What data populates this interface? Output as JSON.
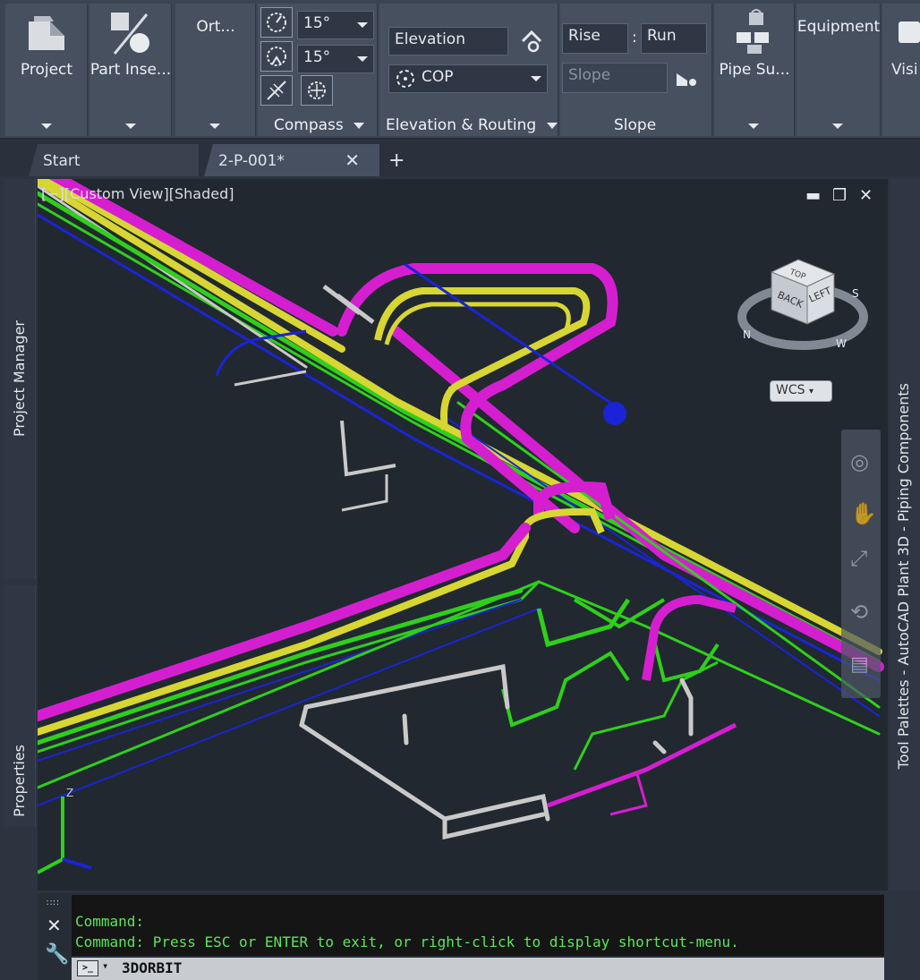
{
  "ribbon": {
    "project": {
      "label": "Project"
    },
    "part_insertion": {
      "label": "Part Inse..."
    },
    "ortho": {
      "label": "Ort..."
    },
    "compass": {
      "angle1": "15°",
      "angle2": "15°",
      "title": "Compass"
    },
    "elevation_routing": {
      "elevation_value": "Elevation",
      "justification": "COP",
      "title": "Elevation & Routing"
    },
    "slope": {
      "rise": "Rise",
      "separator": ":",
      "run": "Run",
      "slope_value": "Slope",
      "title": "Slope"
    },
    "pipe_supports": {
      "label": "Pipe Su..."
    },
    "equipment": {
      "label": "Equipment"
    },
    "visibility": {
      "label": "Visi"
    }
  },
  "tabs": [
    {
      "label": "Start"
    },
    {
      "label": "2-P-001*"
    }
  ],
  "viewport": {
    "label": "[−][Custom View][Shaded]",
    "viewcube": {
      "top_face": "TOP",
      "front_face": "BACK",
      "side_face": "LEFT",
      "compass_n": "N",
      "compass_s": "S",
      "compass_w": "W"
    },
    "wcs_label": "WCS",
    "axis_z": "Z"
  },
  "palettes": {
    "left_top": "Project Manager",
    "left_bottom": "Properties",
    "right": "Tool Palettes - AutoCAD Plant 3D - Piping Components"
  },
  "command_line": {
    "history": [
      "Command:",
      "Command: Press ESC or ENTER to exit, or right-click to display shortcut-menu."
    ],
    "current_command": "3DORBIT"
  },
  "colors": {
    "pipe_magenta": "#d61ed1",
    "pipe_yellow": "#d7d633",
    "pipe_green": "#2fcf1c",
    "pipe_blue": "#1a24d6",
    "pipe_gray": "#c9c9c9",
    "command_text": "#5be65b"
  }
}
